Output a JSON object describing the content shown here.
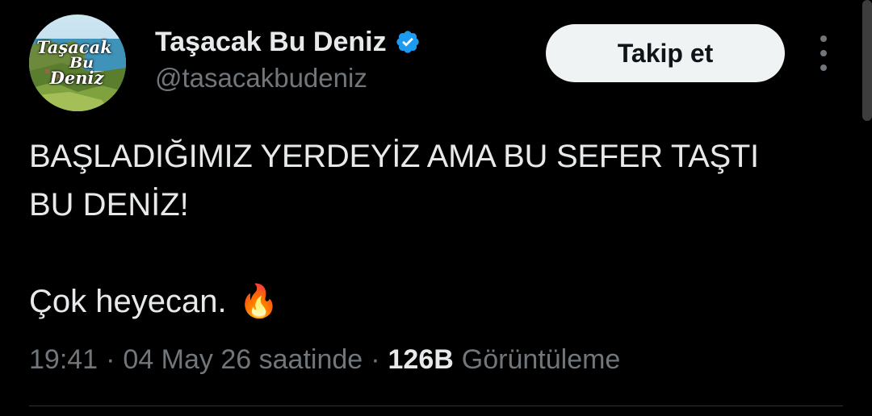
{
  "author": {
    "display_name": "Taşacak Bu Deniz",
    "handle": "@tasacakbudeniz",
    "verified": true,
    "avatar_text": [
      "Taşacak",
      "Bu",
      "Deniz"
    ]
  },
  "actions": {
    "follow_label": "Takip et",
    "more_icon": "more-vertical-icon"
  },
  "tweet": {
    "lines": [
      "BAŞLADIĞIMIZ YERDEYİZ AMA BU SEFER TAŞTI",
      "BU DENİZ!"
    ],
    "second_paragraph": "Çok heyecan.",
    "emoji": "🔥",
    "time": "19:41",
    "separator": "·",
    "date": "04 May 26 saatinde",
    "views_count": "126B",
    "views_label": "Görüntüleme"
  },
  "colors": {
    "background": "#000000",
    "text_primary": "#e7e9ea",
    "text_secondary": "#71767b",
    "verified_blue": "#1d9bf0",
    "follow_bg": "#eff3f4"
  }
}
